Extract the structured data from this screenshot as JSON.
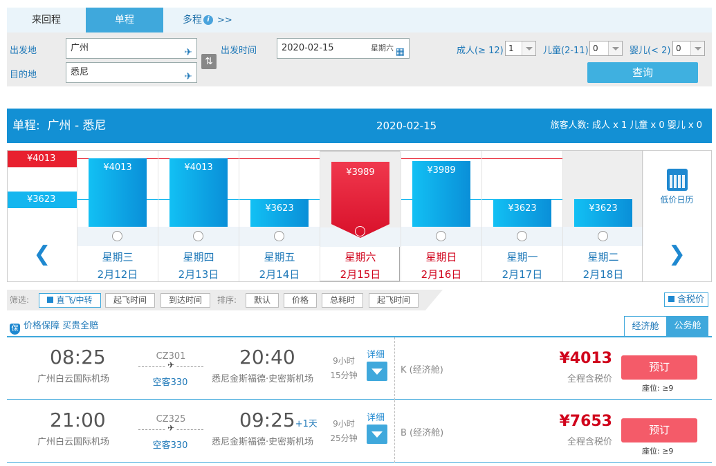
{
  "trip_tabs": {
    "round": "来回程",
    "oneway": "单程",
    "multi": "多程",
    "multi_info": "i",
    "multi_arrow": ">>"
  },
  "search": {
    "from_label": "出发地",
    "from_value": "广州",
    "to_label": "目的地",
    "to_value": "悉尼",
    "date_label": "出发时间",
    "date_value": "2020-02-15",
    "date_weekday": "星期六",
    "adult_label": "成人(≥ 12)",
    "adult_value": "1",
    "child_label": "儿童(2-11)",
    "child_value": "0",
    "infant_label": "婴儿(< 2)",
    "infant_value": "0",
    "query_button": "查询"
  },
  "route": {
    "type": "单程:",
    "cities": "广州 - 悉尼",
    "date": "2020-02-15",
    "passengers": "旅客人数: 成人 x 1  儿童 x 0  婴儿 x 0"
  },
  "calendar": {
    "legend_high": "¥4013",
    "legend_low": "¥3623",
    "low_price_calendar": "低价日历",
    "days": [
      {
        "price": "¥4013",
        "value": 4013,
        "weekday": "星期三",
        "date": "2月12日"
      },
      {
        "price": "¥4013",
        "value": 4013,
        "weekday": "星期四",
        "date": "2月13日"
      },
      {
        "price": "¥3623",
        "value": 3623,
        "weekday": "星期五",
        "date": "2月14日"
      },
      {
        "price": "¥3989",
        "value": 3989,
        "weekday": "星期六",
        "date": "2月15日",
        "selected": true
      },
      {
        "price": "¥3989",
        "value": 3989,
        "weekday": "星期日",
        "date": "2月16日"
      },
      {
        "price": "¥3623",
        "value": 3623,
        "weekday": "星期一",
        "date": "2月17日"
      },
      {
        "price": "¥3623",
        "value": 3623,
        "weekday": "星期二",
        "date": "2月18日"
      }
    ]
  },
  "filters": {
    "label": "筛选:",
    "direct": "直飞/中转",
    "dep_time": "起飞时间",
    "arr_time": "到达时间",
    "sort_label": "排序:",
    "default": "默认",
    "price": "价格",
    "total_time": "总耗时",
    "sort_dep": "起飞时间",
    "tax_incl": "含税价"
  },
  "guarantee": {
    "badge": "保",
    "text": "价格保障 买贵全赔"
  },
  "cabins": {
    "economy": "经济舱",
    "business": "公务舱"
  },
  "flights": [
    {
      "dep_time": "08:25",
      "dep_airport": "广州白云国际机场",
      "flight_no": "CZ301",
      "aircraft": "空客330",
      "arr_time": "20:40",
      "next_day": "",
      "arr_airport": "悉尼金斯福德·史密斯机场",
      "dur_h": "9小时",
      "dur_m": "15分钟",
      "detail": "详细",
      "class": "K (经济舱)",
      "price": "¥4013",
      "price_label": "全程含税价",
      "book": "预订",
      "seats": "座位: ≥9"
    },
    {
      "dep_time": "21:00",
      "dep_airport": "广州白云国际机场",
      "flight_no": "CZ325",
      "aircraft": "空客330",
      "arr_time": "09:25",
      "next_day": "+1天",
      "arr_airport": "悉尼金斯福德·史密斯机场",
      "dur_h": "9小时",
      "dur_m": "25分钟",
      "detail": "详细",
      "class": "B (经济舱)",
      "price": "¥7653",
      "price_label": "全程含税价",
      "book": "预订",
      "seats": "座位: ≥9"
    }
  ],
  "colors": {
    "accent": "#1390d4",
    "price_red": "#d0021b",
    "book_button": "#f45b69"
  }
}
